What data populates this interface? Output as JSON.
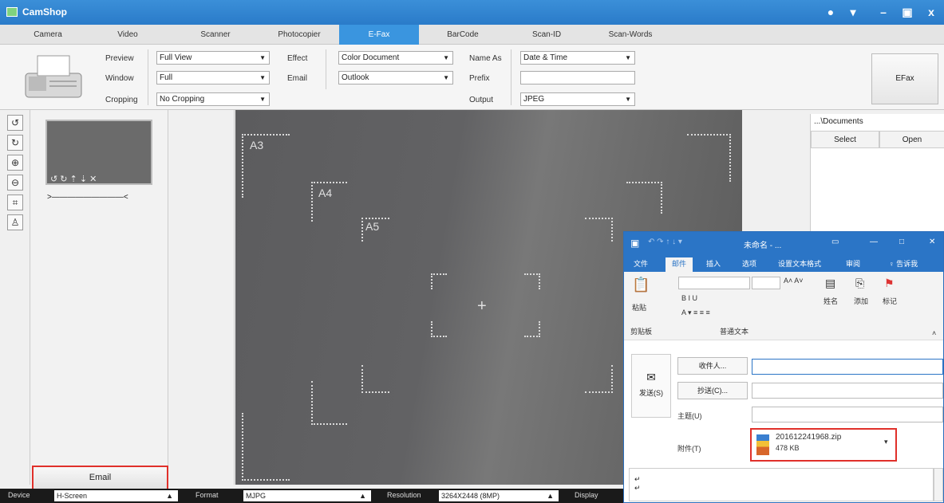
{
  "app": {
    "title": "CamShop"
  },
  "tabs": [
    "Camera",
    "Video",
    "Scanner",
    "Photocopier",
    "E-Fax",
    "BarCode",
    "Scan-ID",
    "Scan-Words"
  ],
  "active_tab": "E-Fax",
  "toolbar": {
    "preview_label": "Preview",
    "preview_value": "Full View",
    "window_label": "Window",
    "window_value": "Full",
    "cropping_label": "Cropping",
    "cropping_value": "No Cropping",
    "effect_label": "Effect",
    "effect_value": "Color Document",
    "email_label": "Email",
    "email_value": "Outlook",
    "nameas_label": "Name As",
    "nameas_value": "Date & Time",
    "prefix_label": "Prefix",
    "prefix_value": "",
    "output_label": "Output",
    "output_value": "JPEG",
    "efax_button": "EFax"
  },
  "thumb": {
    "selector_text": ">—————————<"
  },
  "email_button": "Email",
  "preview_marks": [
    "A3",
    "A4",
    "A5"
  ],
  "right": {
    "path": "...\\Documents",
    "select": "Select",
    "open": "Open"
  },
  "status": {
    "device_label": "Device",
    "device_value": "H-Screen",
    "format_label": "Format",
    "format_value": "MJPG",
    "resolution_label": "Resolution",
    "resolution_value": "3264X2448 (8MP)",
    "display_label": "Display"
  },
  "outlook": {
    "title": "未命名 - ...",
    "tabs": [
      "文件",
      "邮件",
      "插入",
      "选项",
      "设置文本格式",
      "审阅",
      "♀ 告诉我"
    ],
    "active_tab": "邮件",
    "ribbon": {
      "paste": "粘贴",
      "clipboard": "剪贴板",
      "basic_text": "普通文本",
      "names": "姓名",
      "add": "添加",
      "tags": "标记"
    },
    "send": "发送(S)",
    "to": "收件人...",
    "cc": "抄送(C)...",
    "subject": "主题(U)",
    "attach": "附件(T)",
    "attachment_name": "201612241968.zip",
    "attachment_size": "478 KB"
  }
}
